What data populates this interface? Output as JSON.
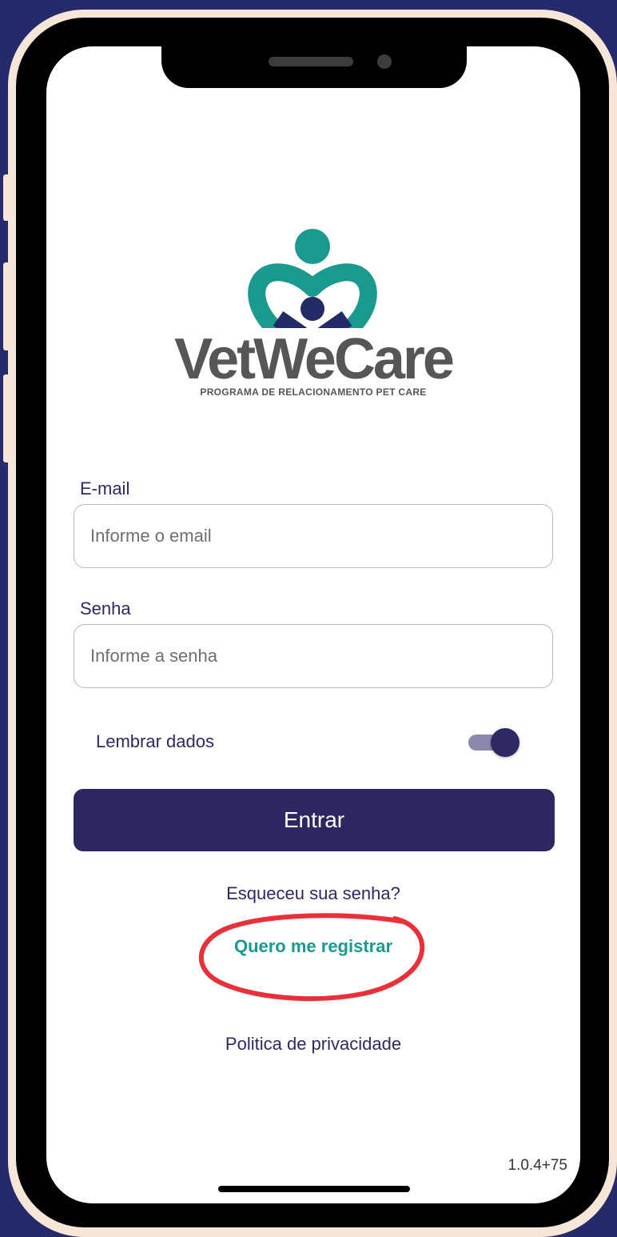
{
  "app": {
    "brand": "VetWeCare",
    "tagline": "PROGRAMA DE RELACIONAMENTO PET CARE"
  },
  "form": {
    "email_label": "E-mail",
    "email_placeholder": "Informe o email",
    "email_value": "",
    "password_label": "Senha",
    "password_placeholder": "Informe a senha",
    "password_value": "",
    "remember_label": "Lembrar dados",
    "remember_on": true,
    "submit_label": "Entrar"
  },
  "links": {
    "forgot_password": "Esqueceu sua senha?",
    "register": "Quero me registrar",
    "privacy": "Politica de privacidade"
  },
  "footer": {
    "version": "1.0.4+75"
  },
  "icons": {
    "logo": "heart-people-logo-icon",
    "annotation": "red-circle-highlight"
  },
  "colors": {
    "background": "#262a6b",
    "primary": "#2c2761",
    "teal": "#1a9a8e",
    "logo_gray": "#555655",
    "annotation_red": "#e8303a"
  }
}
